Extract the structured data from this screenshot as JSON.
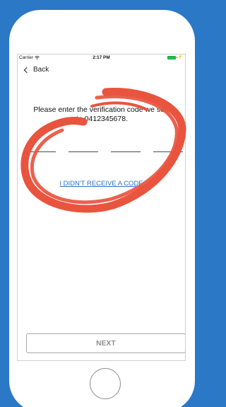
{
  "status_bar": {
    "carrier": "Carrier",
    "time": "2:17 PM"
  },
  "nav": {
    "back_label": "Back"
  },
  "verification": {
    "instruction_line1": "Please enter the verification code we sent",
    "instruction_line2": "to 0412345678.",
    "resend_label": "I DIDN'T RECEIVE A CODE",
    "code_slots": [
      "",
      "",
      "",
      ""
    ]
  },
  "actions": {
    "next_label": "NEXT"
  },
  "colors": {
    "background": "#2a78c6",
    "annotation": "#e9543f",
    "link": "#2e72c9"
  }
}
